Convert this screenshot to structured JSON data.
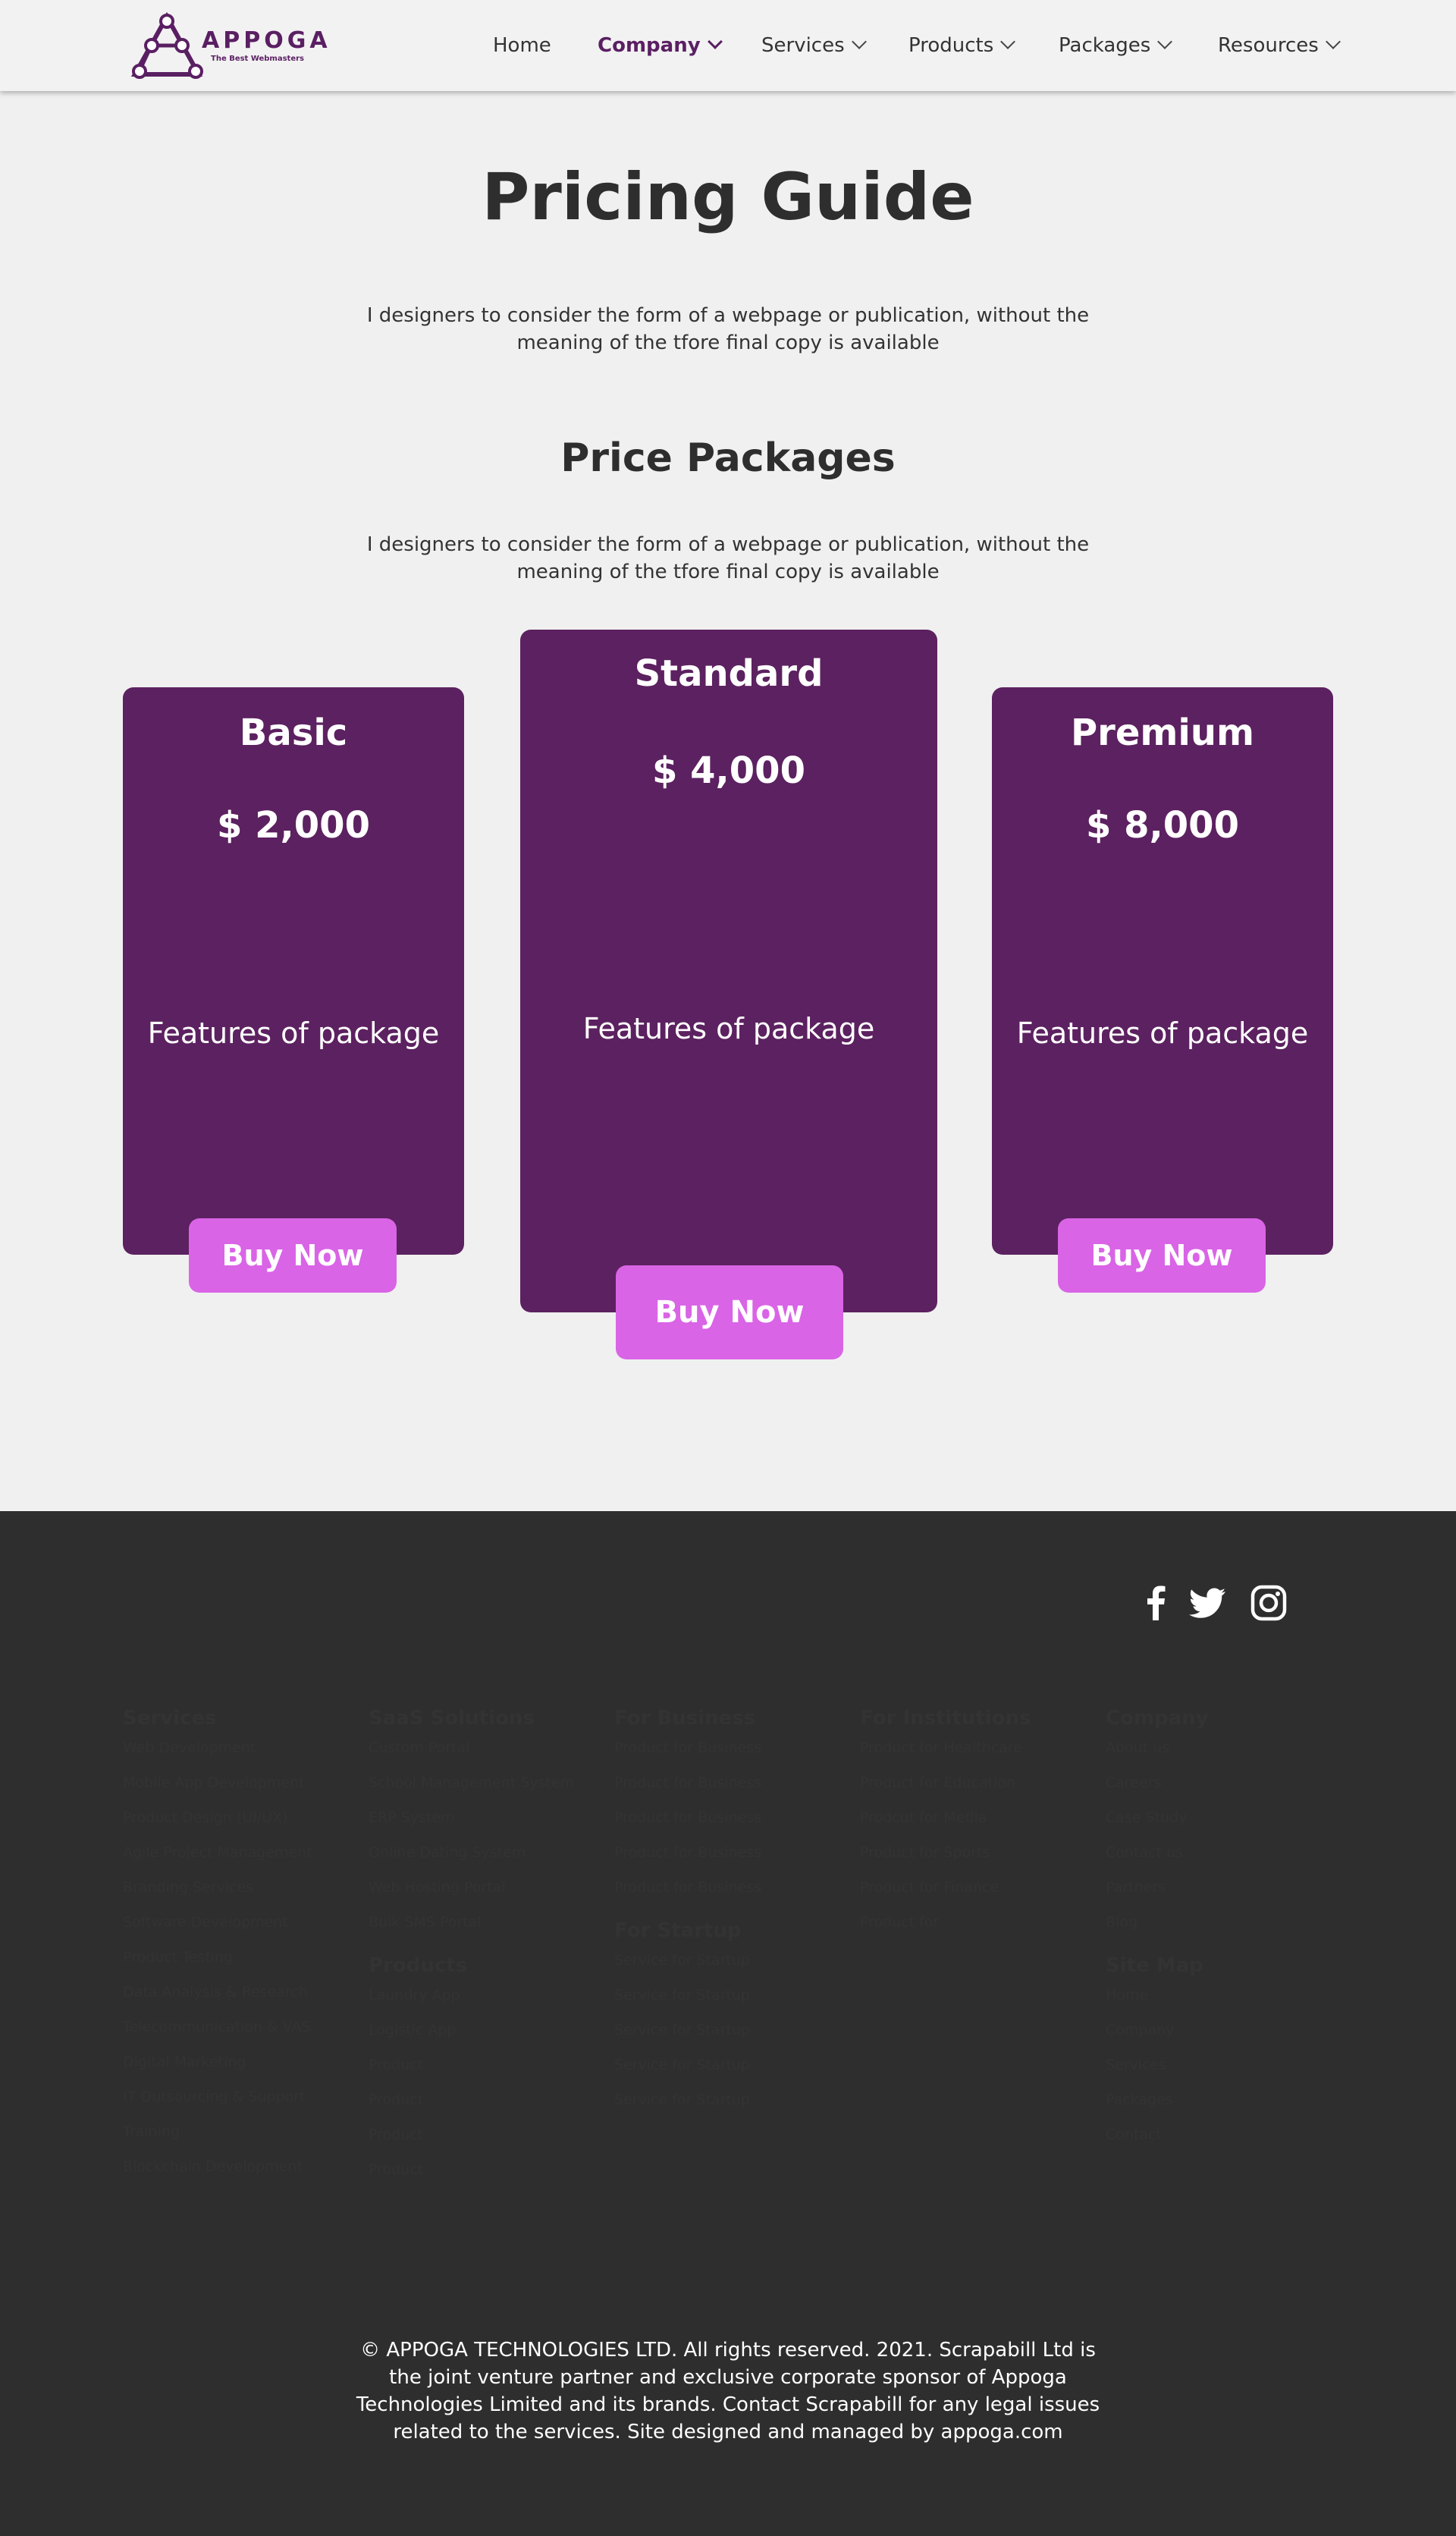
{
  "brand": {
    "name": "APPOGA",
    "tagline": "The Best Webmasters",
    "accent": "#5c2160",
    "button": "#d964e6",
    "footer_bg": "#2e2e2e"
  },
  "nav": [
    {
      "label": "Home"
    },
    {
      "label": "Company",
      "active": true
    },
    {
      "label": "Services"
    },
    {
      "label": "Products"
    },
    {
      "label": "Packages"
    },
    {
      "label": "Resources"
    }
  ],
  "hero": {
    "title": "Pricing Guide",
    "intro": "I designers to consider the form of a webpage or publication, without the meaning of the tfore final copy is available",
    "subtitle": "Price Packages",
    "intro2": "I designers to consider the form of a webpage or publication, without the meaning of the tfore final copy is available"
  },
  "packages": [
    {
      "name": "Basic",
      "price": "$ 2,000",
      "features": "Features of package",
      "cta": "Buy Now"
    },
    {
      "name": "Standard",
      "price": "$ 4,000",
      "features": "Features of package",
      "cta": "Buy Now"
    },
    {
      "name": "Premium",
      "price": "$ 8,000",
      "features": "Features of package",
      "cta": "Buy Now"
    }
  ],
  "social": [
    "facebook-icon",
    "twitter-icon",
    "instagram-icon"
  ],
  "footer": {
    "services": {
      "title": "Services",
      "links": [
        "Web Development",
        "Mobile App Development",
        "Product Design (UI/UX)",
        "Agile Project Management",
        "Branding Services",
        "Software Development",
        "Product Testing",
        "Data Analysis & Research",
        "Telecommunication & VAS",
        "Digital Marketing",
        "IT Outsourcing & Support",
        "Training",
        "Blockchain Development"
      ]
    },
    "saas": {
      "title": "SaaS Solutions",
      "links": [
        "Custom Portal",
        "School Management System",
        "ERP System",
        "Online Dating System",
        "Web Hosting Portal",
        "Bulk SMS Portal"
      ]
    },
    "products": {
      "title": "Products",
      "links": [
        "Laundry App",
        "Logistic App",
        "Product",
        "Product",
        "Product",
        "Product"
      ]
    },
    "business": {
      "title": "For Business",
      "links": [
        "Product for Business",
        "Product for Business",
        "Product for Business",
        "Product for Business",
        "Product for Business"
      ]
    },
    "startup": {
      "title": "For Startup",
      "links": [
        "Service for Startup",
        "Service for Startup",
        "Service for Startup",
        "Service for Startup",
        "Service for Startup"
      ]
    },
    "institutions": {
      "title": "For Institutions",
      "links": [
        "Product for Healthcare",
        "Product for Education",
        "Prodcut for Media",
        "Product for Sports",
        "Product for Finance",
        "Product for"
      ]
    },
    "company": {
      "title": "Company",
      "links": [
        "About us",
        "Careers",
        "Case Study",
        "Contact us",
        "Partners",
        "Blog"
      ]
    },
    "sitemap": {
      "title": "Site Map",
      "links": [
        "Home",
        "Company",
        "Services",
        "Packages",
        "Contact"
      ]
    },
    "copyright": "© APPOGA TECHNOLOGIES LTD. All rights reserved. 2021. Scrapabill Ltd is the joint venture partner and exclusive corporate sponsor of Appoga Technologies Limited and its brands. Contact Scrapabill for any legal issues related to the services. Site designed and managed by appoga.com"
  }
}
